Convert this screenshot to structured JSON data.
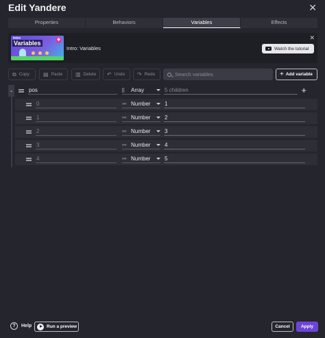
{
  "window": {
    "title": "Edit Yandere",
    "close_glyph": "✕"
  },
  "tabs": [
    {
      "label": "Properties",
      "active": false
    },
    {
      "label": "Behaviors",
      "active": false
    },
    {
      "label": "Variables",
      "active": true
    },
    {
      "label": "Effects",
      "active": false
    }
  ],
  "tutorial": {
    "thumbnail_small": "Intro",
    "thumbnail_title": "Variables",
    "label": "Intro: Variables",
    "watch_label": "Watch the tutorial",
    "close_glyph": "✕"
  },
  "toolbar": {
    "copy": "Copy",
    "paste": "Paste",
    "delete": "Delete",
    "undo": "Undo",
    "redo": "Redo",
    "search_placeholder": "Search variables",
    "add_variable": "Add variable"
  },
  "variables": {
    "parent": {
      "name": "pos",
      "type": "Array",
      "type_icon": "[]",
      "value": "5 children"
    },
    "children": [
      {
        "name": "0",
        "type": "Number",
        "type_icon": "›››",
        "value": "1"
      },
      {
        "name": "1",
        "type": "Number",
        "type_icon": "›››",
        "value": "2"
      },
      {
        "name": "2",
        "type": "Number",
        "type_icon": "›››",
        "value": "3"
      },
      {
        "name": "3",
        "type": "Number",
        "type_icon": "›››",
        "value": "4"
      },
      {
        "name": "4",
        "type": "Number",
        "type_icon": "›››",
        "value": "5"
      }
    ]
  },
  "footer": {
    "help": "Help",
    "run_preview": "Run a preview",
    "cancel": "Cancel",
    "apply": "Apply"
  },
  "colors": {
    "background": "#25252d",
    "accent": "#6c45d8",
    "row": "#2e2e36"
  }
}
